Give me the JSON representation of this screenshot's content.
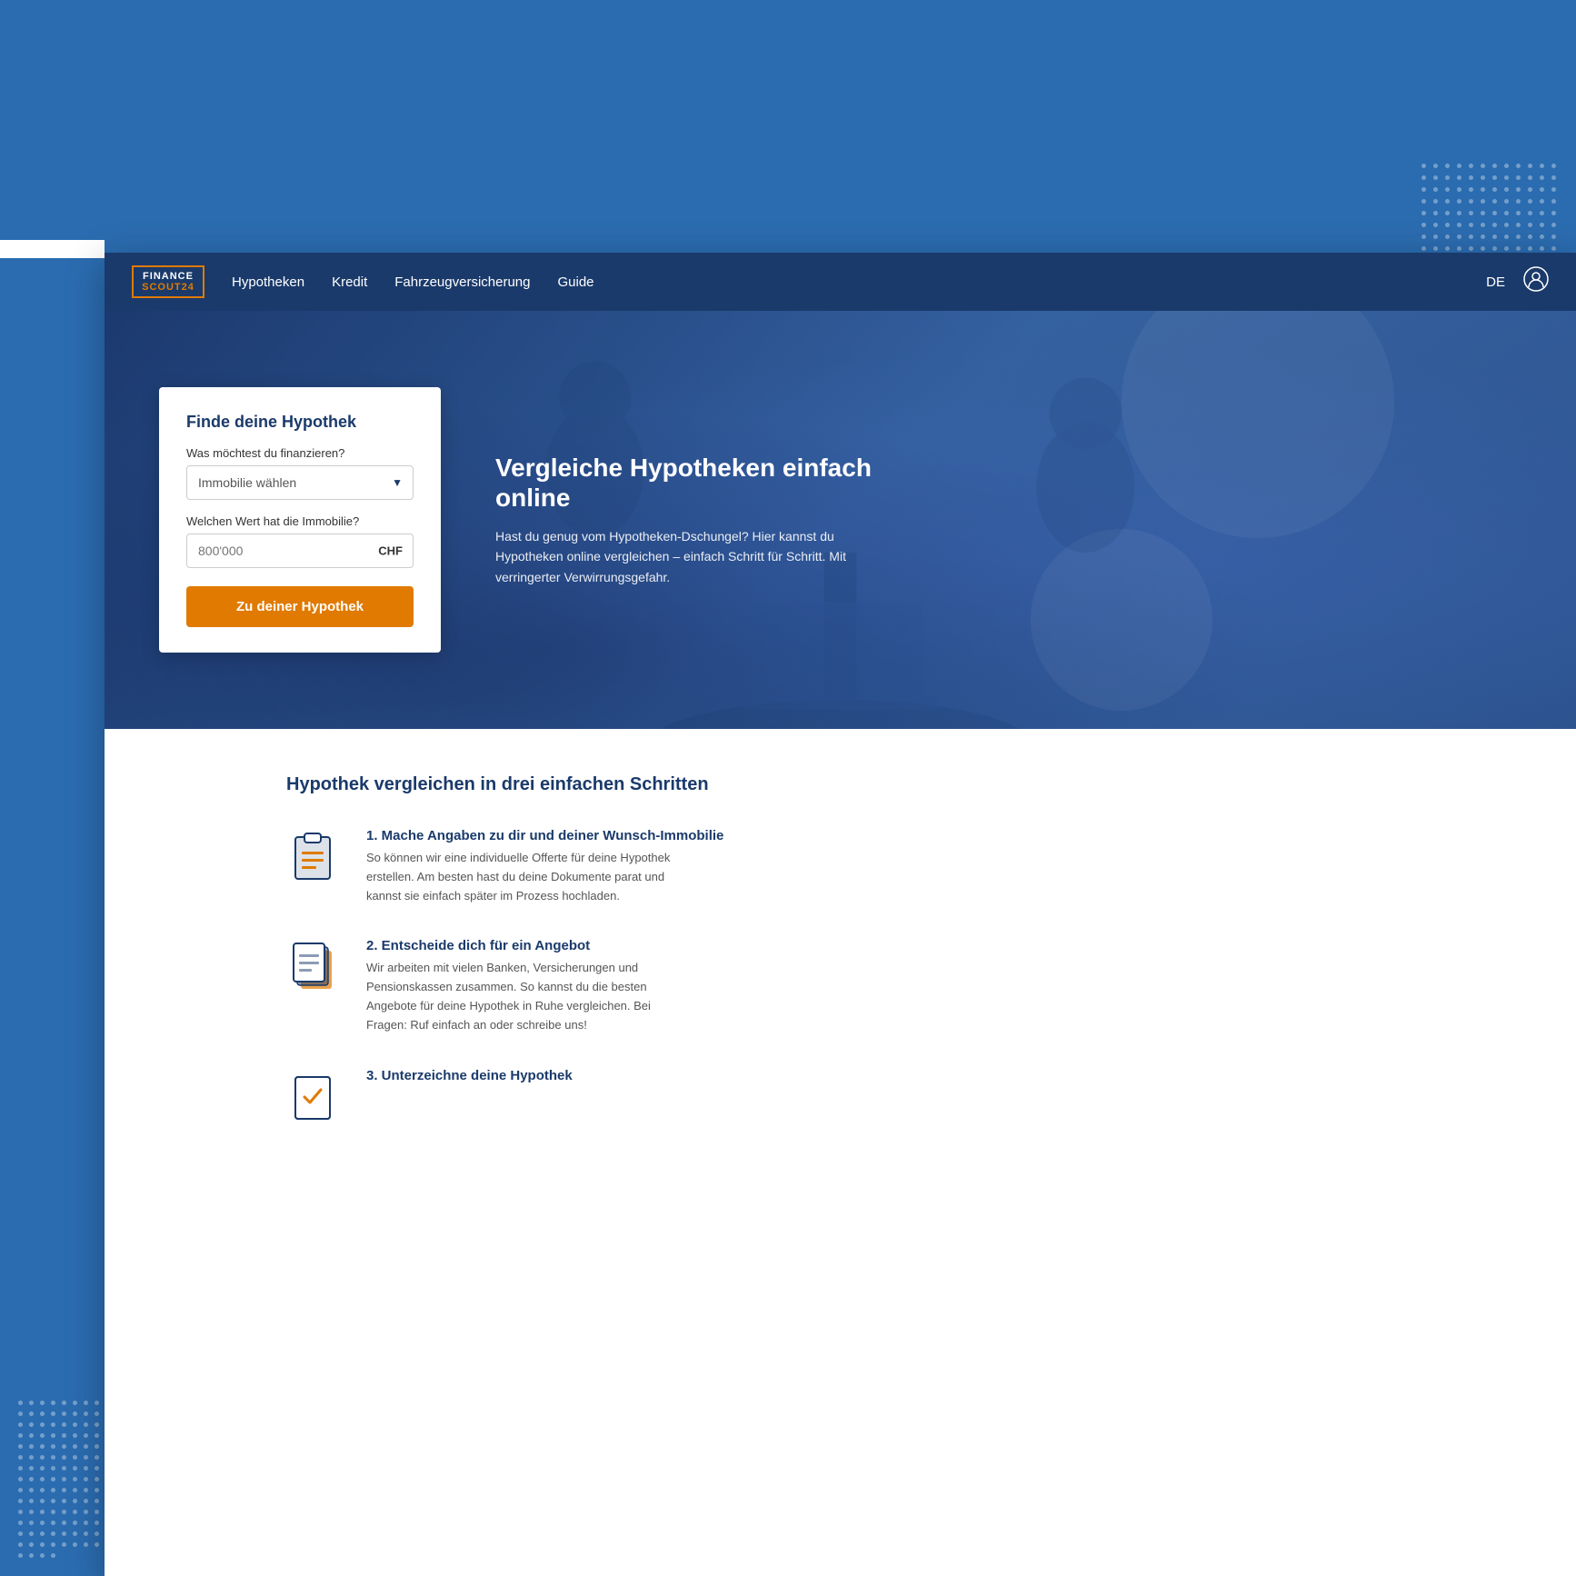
{
  "page": {
    "bg_color": "#2b6cb0"
  },
  "navbar": {
    "logo_line1": "FINANCE",
    "logo_line2": "SCOUT24",
    "links": [
      {
        "label": "Hypotheken",
        "id": "hypotheken"
      },
      {
        "label": "Kredit",
        "id": "kredit"
      },
      {
        "label": "Fahrzeugversicherung",
        "id": "fahrzeug"
      },
      {
        "label": "Guide",
        "id": "guide"
      }
    ],
    "lang": "DE",
    "user_icon": "⊙"
  },
  "hero": {
    "form": {
      "title": "Finde deine Hypothek",
      "field1_label": "Was möchtest du finanzieren?",
      "field1_placeholder": "Immobilie wählen",
      "field2_label": "Welchen Wert hat die Immobilie?",
      "field2_placeholder": "800'000",
      "field2_suffix": "CHF",
      "cta_label": "Zu deiner Hypothek"
    },
    "headline": "Vergleiche Hypotheken einfach online",
    "subtext": "Hast du genug vom Hypotheken-Dschungel? Hier kannst du Hypotheken online vergleichen – einfach Schritt für Schritt. Mit verringerter Verwirrungsgefahr."
  },
  "content": {
    "section_title": "Hypothek vergleichen in drei einfachen Schritten",
    "steps": [
      {
        "id": "step1",
        "title": "1. Mache Angaben zu dir und deiner Wunsch-Immobilie",
        "desc": "So können wir eine individuelle Offerte für deine Hypothek erstellen. Am besten hast du deine Dokumente parat und kannst sie einfach später im Prozess hochladen."
      },
      {
        "id": "step2",
        "title": "2. Entscheide dich für ein Angebot",
        "desc": "Wir arbeiten mit vielen Banken, Versicherungen und Pensionskassen zusammen. So kannst du die besten Angebote für deine Hypothek in Ruhe vergleichen. Bei Fragen: Ruf einfach an oder schreibe uns!"
      }
    ]
  },
  "dots": {
    "count": 80,
    "color": "rgba(255,255,255,0.4)"
  }
}
